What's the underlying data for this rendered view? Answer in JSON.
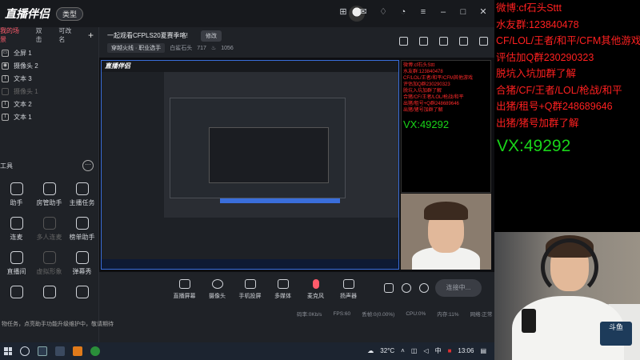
{
  "app": {
    "logo": "直播伴侣",
    "logo_tag": "类型",
    "sidebar": {
      "tabs": [
        "我的场景",
        "双击",
        "可改名"
      ],
      "scenes": [
        {
          "icon": "▭",
          "label": "全屏 1",
          "dim": false
        },
        {
          "icon": "◉",
          "label": "摄像头 2",
          "dim": false
        },
        {
          "icon": "T",
          "label": "文本 3",
          "dim": false
        },
        {
          "icon": "",
          "label": "摄像头 1",
          "dim": true
        },
        {
          "icon": "T",
          "label": "文本 2",
          "dim": false
        },
        {
          "icon": "T",
          "label": "文本 1",
          "dim": false
        }
      ],
      "tools_title": "工具",
      "tools_more": "···",
      "tools": [
        {
          "label": "助手",
          "dim": false
        },
        {
          "label": "房管助手",
          "dim": false
        },
        {
          "label": "主播任务",
          "dim": false
        },
        {
          "label": "连麦",
          "dim": false
        },
        {
          "label": "多人连麦",
          "dim": true
        },
        {
          "label": "榜单助手",
          "dim": false
        },
        {
          "label": "直播间",
          "dim": false
        },
        {
          "label": "虚拟形象",
          "dim": true
        },
        {
          "label": "弹幕秀",
          "dim": false
        },
        {
          "label": "",
          "dim": false
        },
        {
          "label": "",
          "dim": false
        },
        {
          "label": "",
          "dim": false
        }
      ],
      "footer": "物任务，点亮助手功能升级维护中，敬请期待"
    },
    "header": {
      "title": "一起观看CFPLS20夏赛季咯!",
      "edit": "修改",
      "category": "穿越火线 · 职业选手",
      "user": "白鲨石头",
      "count": "717",
      "likes": "1056"
    },
    "toolbar": [
      {
        "label": "直播屏幕",
        "icon": "screen-icon",
        "shape": "rect"
      },
      {
        "label": "摄像头",
        "icon": "camera-icon",
        "shape": "round"
      },
      {
        "label": "手机投屏",
        "icon": "phone-cast-icon",
        "shape": "rect"
      },
      {
        "label": "多媒体",
        "icon": "media-icon",
        "shape": "rect"
      },
      {
        "label": "麦克风",
        "icon": "microphone-icon",
        "shape": "mic"
      },
      {
        "label": "扬声器",
        "icon": "speaker-icon",
        "shape": "rect"
      }
    ],
    "start_button": "连接中...",
    "status": {
      "bitrate": "码率:0Kb/s",
      "fps": "FPS:60",
      "drop": "丢帧:0(0.00%)",
      "cpu": "CPU:0%",
      "mem": "内存:11%",
      "net": "网络:正常"
    },
    "preview": {
      "inner_overlay": [
        "微博:cf石头Sttt",
        "水友群:123840478",
        "CF/LOL/王者/和平/CFM其他游戏",
        "评估加Q群230290323",
        "脱坑入坑加群了解",
        "合猪/CF/王者/LOL/枪战/和平",
        "出猪/租号+Q群248689646",
        "出猪/猪号加群了解"
      ],
      "inner_vx": "VX:49292"
    }
  },
  "taskbar": {
    "temperature": "32°C",
    "ime": "中",
    "time": "13:06"
  },
  "overlay": {
    "lines": [
      "微博:cf石头Sttt",
      "水友群:123840478",
      "CF/LOL/王者/和平/CFM其他游戏",
      "评估加Q群230290323",
      "脱坑入坑加群了解",
      "合猪/CF/王者/LOL/枪战/和平",
      "出猪/租号+Q群248689646",
      "出猪/猪号加群了解"
    ],
    "vx": "VX:49292",
    "text_color": "#ff2020",
    "vx_color": "#19d419"
  },
  "webcam": {
    "badge": "斗鱼"
  }
}
